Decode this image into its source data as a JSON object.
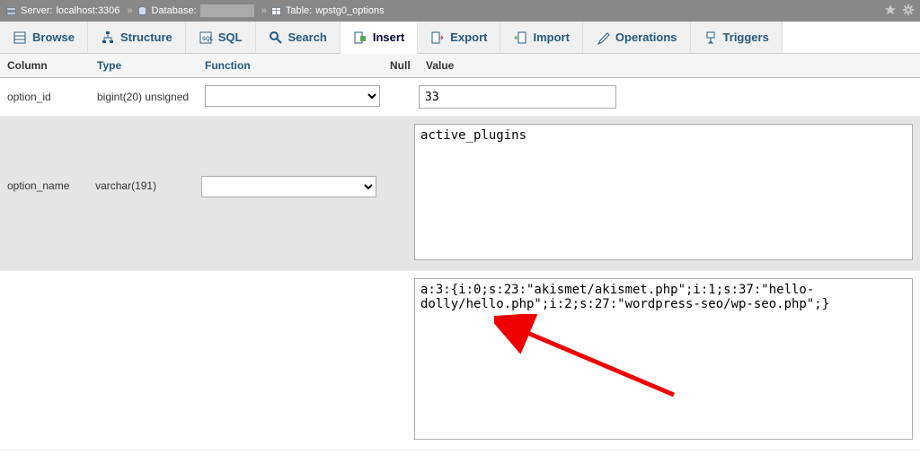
{
  "breadcrumb": {
    "server_label": "Server:",
    "server_value": "localhost:3306",
    "database_label": "Database:",
    "table_label": "Table:",
    "table_value": "wpstg0_options"
  },
  "tabs": [
    {
      "id": "browse",
      "label": "Browse"
    },
    {
      "id": "structure",
      "label": "Structure"
    },
    {
      "id": "sql",
      "label": "SQL"
    },
    {
      "id": "search",
      "label": "Search"
    },
    {
      "id": "insert",
      "label": "Insert"
    },
    {
      "id": "export",
      "label": "Export"
    },
    {
      "id": "import",
      "label": "Import"
    },
    {
      "id": "operations",
      "label": "Operations"
    },
    {
      "id": "triggers",
      "label": "Triggers"
    }
  ],
  "active_tab": "insert",
  "headers": {
    "column": "Column",
    "type": "Type",
    "function": "Function",
    "null": "Null",
    "value": "Value"
  },
  "rows": [
    {
      "column": "option_id",
      "type": "bigint(20) unsigned",
      "value": "33",
      "input_kind": "text"
    },
    {
      "column": "option_name",
      "type": "varchar(191)",
      "value": "active_plugins",
      "input_kind": "textarea"
    },
    {
      "column": "",
      "type": "",
      "value": "a:3:{i:0;s:23:\"akismet/akismet.php\";i:1;s:37:\"hello-dolly/hello.php\";i:2;s:27:\"wordpress-seo/wp-seo.php\";}",
      "input_kind": "textarea_only"
    }
  ],
  "icons": {
    "server": "server-icon",
    "database": "database-icon",
    "table": "table-icon",
    "star": "star-icon",
    "gear": "gear-icon"
  }
}
